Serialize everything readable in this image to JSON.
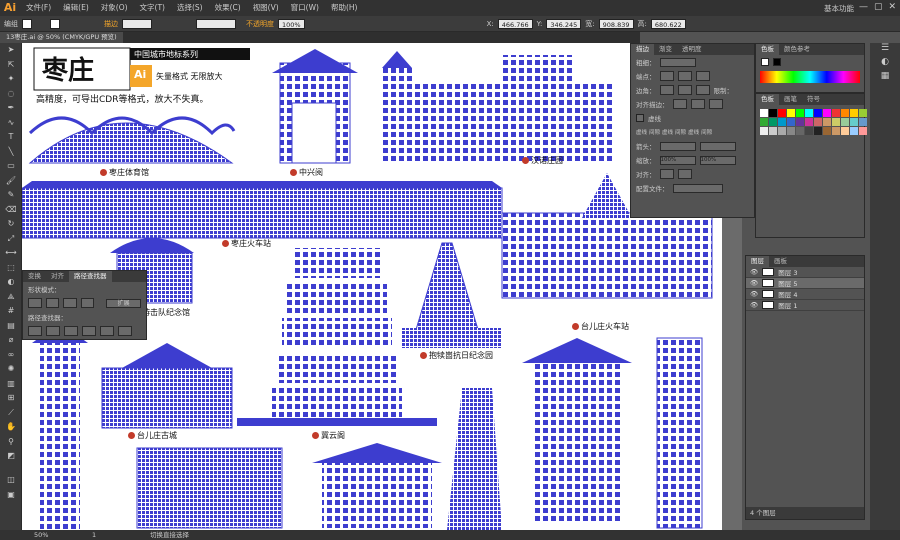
{
  "app": {
    "logo": "Ai",
    "workspace": "基本功能",
    "window_controls": [
      "—",
      "▢",
      "✕"
    ]
  },
  "menu": [
    "文件(F)",
    "编辑(E)",
    "对象(O)",
    "文字(T)",
    "选择(S)",
    "效果(C)",
    "视图(V)",
    "窗口(W)",
    "帮助(H)"
  ],
  "control_bar": {
    "selection_label": "编组",
    "stroke_label": "描边",
    "opacity_label": "不透明度",
    "opacity_value": "100%",
    "x_label": "X:",
    "x_value": "466.766",
    "y_label": "Y:",
    "y_value": "346.245",
    "w_label": "宽:",
    "w_value": "908.839",
    "h_label": "高:",
    "h_value": "680.622"
  },
  "document_tab": "13枣庄.ai @ 50% (CMYK/GPU 预览)",
  "artwork": {
    "logo_text": "枣庄",
    "banner": "中国城市地标系列",
    "ai_badge": "Ai",
    "format_text": "矢量格式 无限放大",
    "tagline": "高精度，可导出CDR等格式，放大不失真。",
    "landmarks": [
      "枣庄体育馆",
      "中兴阅",
      "汉诺庄园",
      "枣庄火车站",
      "台儿庄火车站",
      "铁道游击队纪念馆",
      "抱犊崮抗日纪念园",
      "台儿庄古城",
      "冀云阁"
    ]
  },
  "pathfinder": {
    "tabs": [
      "变换",
      "对齐",
      "路径查找器"
    ],
    "shape_modes_label": "形状模式：",
    "expand_label": "扩展",
    "pathfinders_label": "路径查找器："
  },
  "stroke_panel": {
    "tabs": [
      "描边",
      "渐变",
      "透明度"
    ],
    "weight_label": "粗细：",
    "cap_label": "端点：",
    "corner_label": "边角：",
    "limit_label": "限制：",
    "align_label": "对齐描边：",
    "dashed_label": "虚线",
    "dash_labels": [
      "虚线",
      "间隙",
      "虚线",
      "间隙",
      "虚线",
      "间隙"
    ],
    "arrow_label": "箭头：",
    "scale_label": "缩放：",
    "scale_values": [
      "100%",
      "100%"
    ],
    "align2_label": "对齐：",
    "profile_label": "配置文件："
  },
  "color_panel": {
    "tabs": [
      "色板",
      "颜色参考"
    ],
    "swatch_tabs": [
      "色板",
      "画笔",
      "符号"
    ]
  },
  "layers_panel": {
    "tabs": [
      "图层",
      "画板"
    ],
    "layers": [
      "图层 3",
      "图层 5",
      "图层 4",
      "图层 1"
    ],
    "selected_index": 1,
    "count_label": "4 个图层"
  },
  "status": {
    "zoom": "50%",
    "page": "1",
    "message": "切换直接选择"
  },
  "colors": {
    "accent": "#f4a62a",
    "artwork_blue": "#3d3dcf"
  }
}
